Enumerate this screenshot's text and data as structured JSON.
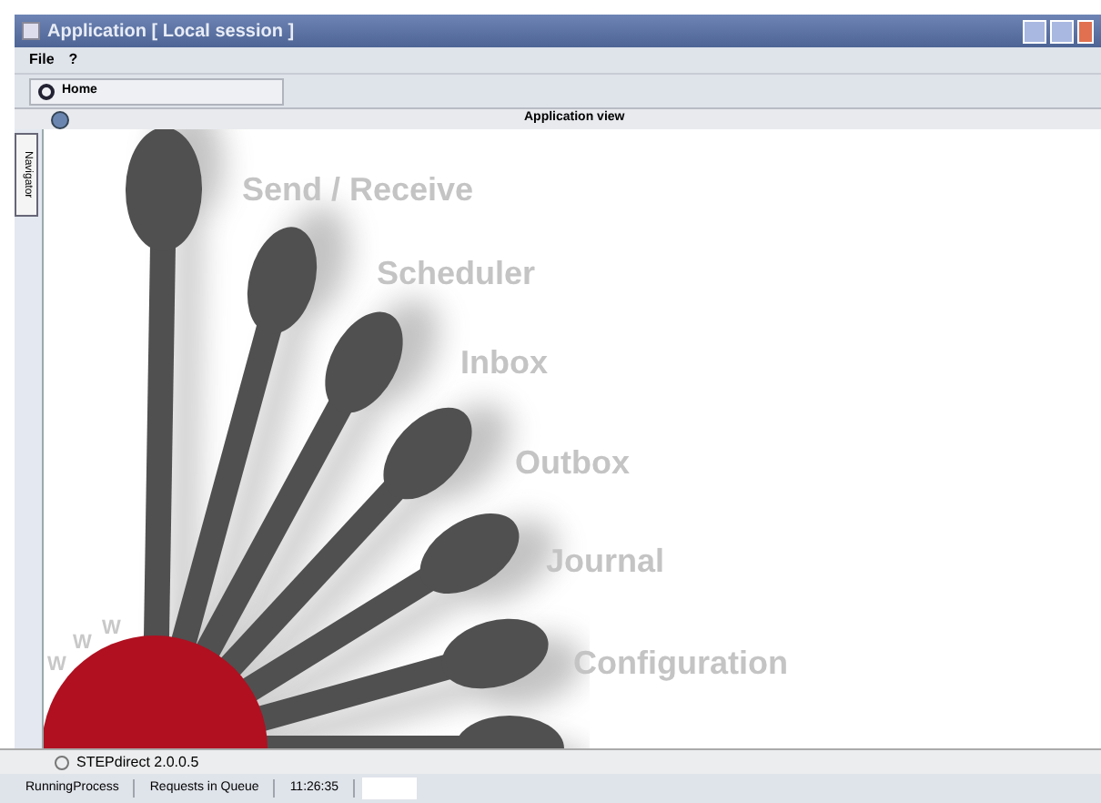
{
  "window": {
    "title": "Application [ Local session ]"
  },
  "menu": [
    {
      "label": "File"
    },
    {
      "label": "?"
    }
  ],
  "toolbar": {
    "home": "Home"
  },
  "view": {
    "title": "Application view",
    "navigator_tab": "Navigator"
  },
  "canvas": {
    "items": [
      {
        "label": "Send / Receive"
      },
      {
        "label": "Scheduler"
      },
      {
        "label": "Inbox"
      },
      {
        "label": "Outbox"
      },
      {
        "label": "Journal"
      },
      {
        "label": "Configuration"
      }
    ],
    "logo_letters": [
      "W",
      "W",
      "W"
    ]
  },
  "version": "STEPdirect 2.0.0.5",
  "status_bar": [
    "RunningProcess",
    "Requests in Queue",
    "11:26:35"
  ]
}
